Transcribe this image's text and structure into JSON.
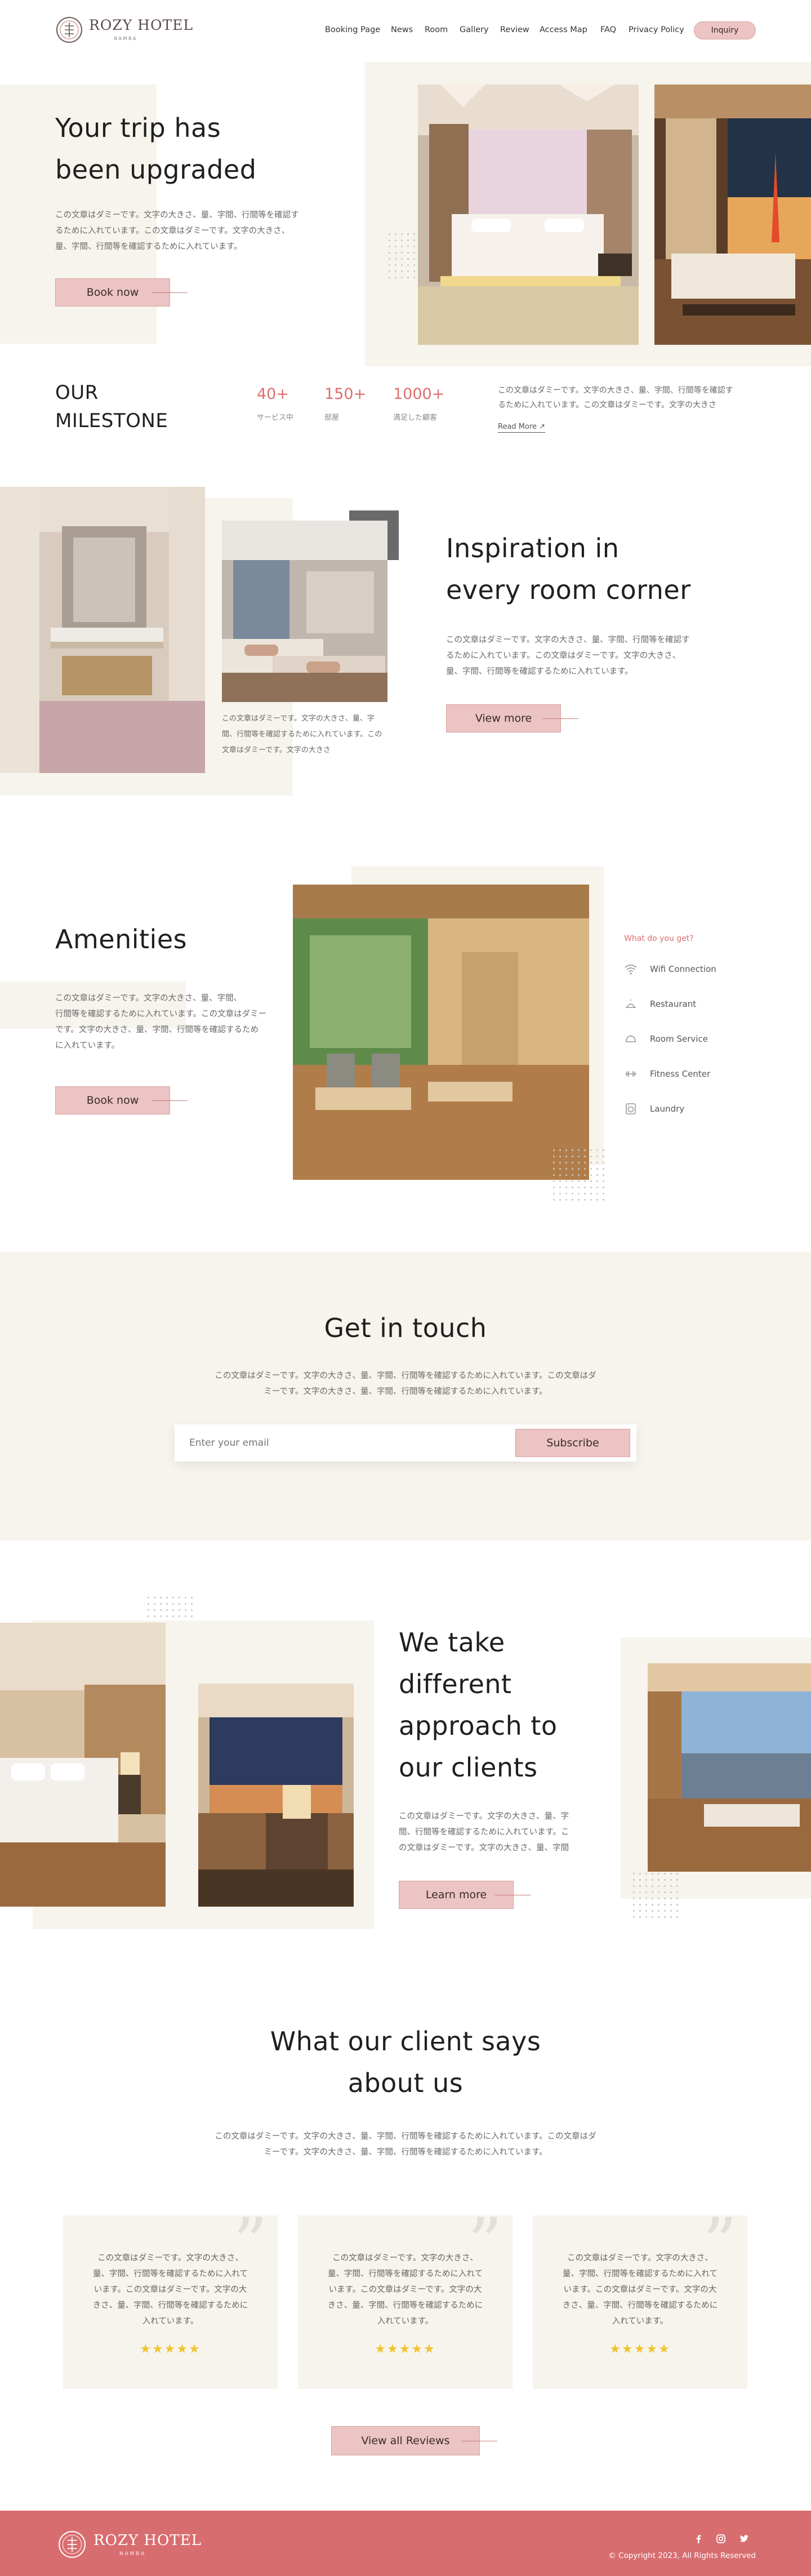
{
  "brand": {
    "name": "ROZY HOTEL",
    "sub": "N A M B A"
  },
  "nav": {
    "items": [
      "Booking Page",
      "News",
      "Room",
      "Gallery",
      "Review",
      "Access Map",
      "FAQ",
      "Privacy Policy"
    ],
    "inquiry": "Inquiry"
  },
  "hero": {
    "title_line1": "Your trip has",
    "title_line2": "been upgraded",
    "text_lines": [
      "この文章はダミーです。文字の大きさ、量、字間、行間等を確認す",
      "るために入れています。この文章はダミーです。文字の大きさ、",
      "量、字間、行間等を確認するために入れています。"
    ],
    "button": "Book now"
  },
  "milestone": {
    "title_line1": "OUR",
    "title_line2": "MILESTONE",
    "stats": [
      {
        "value": "40+",
        "label": "サービス中"
      },
      {
        "value": "150+",
        "label": "部屋"
      },
      {
        "value": "1000+",
        "label": "満足した顧客"
      }
    ],
    "text_lines": [
      "この文章はダミーです。文字の大きさ、量、字間、行間等を確認す",
      "るために入れています。この文章はダミーです。文字の大きさ"
    ],
    "read_more": "Read More ↗"
  },
  "inspiration": {
    "title_line1": "Inspiration in",
    "title_line2": "every room corner",
    "caption_lines": [
      "この文章はダミーです。文字の大きさ、量、字",
      "間、行間等を確認するために入れています。この",
      "文章はダミーです。文字の大きさ"
    ],
    "text_lines": [
      "この文章はダミーです。文字の大きさ、量、字間、行間等を確認す",
      "るために入れています。この文章はダミーです。文字の大きさ、",
      "量、字間、行間等を確認するために入れています。"
    ],
    "button": "View more"
  },
  "amenities": {
    "title": "Amenities",
    "text_lines": [
      "この文章はダミーです。文字の大きさ、量、字間、",
      "行間等を確認するために入れています。この文章はダミー",
      "です。文字の大きさ、量、字間、行間等を確認するため",
      "に入れています。"
    ],
    "button": "Book now",
    "what_label": "What do you get?",
    "items": [
      {
        "label": "Wifi Connection",
        "icon": "wifi-icon"
      },
      {
        "label": "Restaurant",
        "icon": "restaurant-icon"
      },
      {
        "label": "Room Service",
        "icon": "room-service-icon"
      },
      {
        "label": "Fitness Center",
        "icon": "dumbbell-icon"
      },
      {
        "label": "Laundry",
        "icon": "laundry-icon"
      }
    ]
  },
  "contact": {
    "title": "Get in touch",
    "text_lines": [
      "この文章はダミーです。文字の大きさ、量、字間、行間等を確認するために入れています。この文章はダ",
      "ミーです。文字の大きさ、量、字間、行間等を確認するために入れています。"
    ],
    "placeholder": "Enter your email",
    "subscribe": "Subscribe"
  },
  "approach": {
    "title_lines": [
      "We take",
      "different",
      "approach to",
      "our clients"
    ],
    "text_lines": [
      "この文章はダミーです。文字の大きさ、量、字",
      "間、行間等を確認するために入れています。こ",
      "の文章はダミーです。文字の大きさ、量、字間"
    ],
    "button": "Learn more"
  },
  "reviews": {
    "title_line1": "What our client says",
    "title_line2": "about us",
    "text_lines": [
      "この文章はダミーです。文字の大きさ、量、字間、行間等を確認するために入れています。この文章はダ",
      "ミーです。文字の大きさ、量、字間、行間等を確認するために入れています。"
    ],
    "cards": [
      {
        "text": "この文章はダミーです。文字の大きさ、量、字間、行間等を確認するために入れています。この文章はダミーです。文字の大きさ、量、字間、行間等を確認するために入れています。",
        "stars": "★★★★★"
      },
      {
        "text": "この文章はダミーです。文字の大きさ、量、字間、行間等を確認するために入れています。この文章はダミーです。文字の大きさ、量、字間、行間等を確認するために入れています。",
        "stars": "★★★★★"
      },
      {
        "text": "この文章はダミーです。文字の大きさ、量、字間、行間等を確認するために入れています。この文章はダミーです。文字の大きさ、量、字間、行間等を確認するために入れています。",
        "stars": "★★★★★"
      }
    ],
    "button": "View all Reviews"
  },
  "footer": {
    "copyright": "© Copyright 2023, All Rights Reserved",
    "social": [
      "facebook-icon",
      "instagram-icon",
      "twitter-icon"
    ]
  },
  "colors": {
    "accent": "#ebc4c3",
    "accent_text": "#de6f6e",
    "cream": "#f6f4ec",
    "footer": "#d86d70"
  }
}
